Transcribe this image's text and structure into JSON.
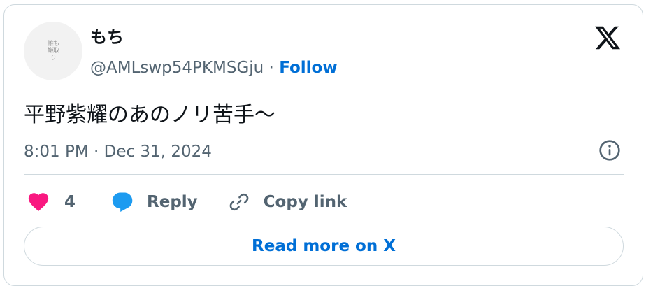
{
  "tweet": {
    "author": {
      "display_name": "もち",
      "handle": "@AMLswp54PKMSGju",
      "avatar_text": "誰も嫌取り"
    },
    "separator": " · ",
    "follow_label": "Follow",
    "text": "平野紫耀のあのノリ苦手〜",
    "timestamp": "8:01 PM · Dec 31, 2024",
    "actions": {
      "like_count": "4",
      "reply_label": "Reply",
      "copy_label": "Copy link"
    },
    "read_more_label": "Read more on X"
  },
  "colors": {
    "like": "#f91880",
    "reply": "#1d9bf0",
    "link": "#006fd6",
    "secondary_text": "#536471",
    "primary_text": "#0f1419",
    "border": "#cfd9de"
  },
  "icons": {
    "brand": "x-logo-icon",
    "info": "info-icon",
    "like": "heart-icon",
    "reply": "speech-bubble-icon",
    "copy": "link-icon"
  }
}
